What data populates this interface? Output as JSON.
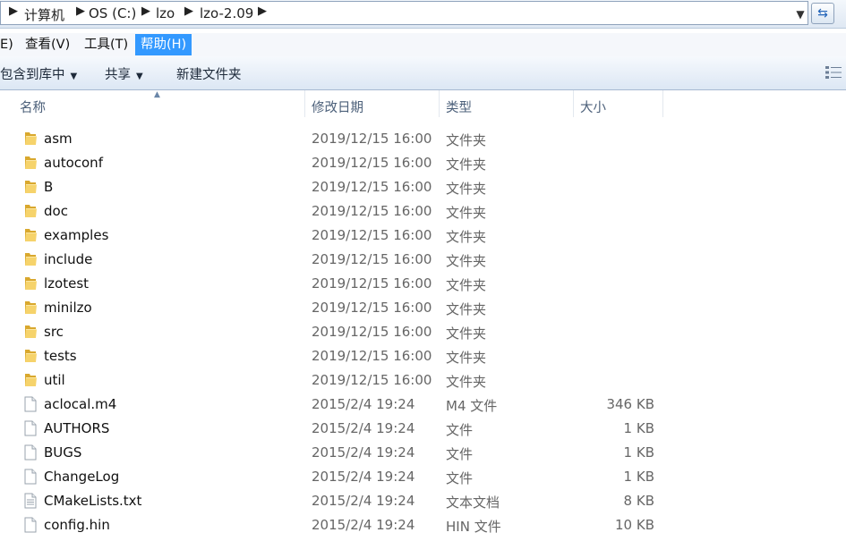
{
  "address": {
    "crumbs": [
      "计算机",
      "OS (C:)",
      "lzo",
      "lzo-2.09"
    ],
    "dropdown_icon": "chevron-down-icon",
    "refresh_icon": "refresh-icon"
  },
  "menu": {
    "items": [
      "E)",
      "查看(V)",
      "工具(T)",
      "帮助(H)"
    ],
    "active_index": 3
  },
  "commands": {
    "include_library": "包含到库中",
    "share": "共享",
    "new_folder": "新建文件夹"
  },
  "columns": {
    "name": "名称",
    "date": "修改日期",
    "type": "类型",
    "size": "大小"
  },
  "files": [
    {
      "name": "asm",
      "date": "2019/12/15 16:00",
      "type": "文件夹",
      "size": "",
      "icon": "folder-icon"
    },
    {
      "name": "autoconf",
      "date": "2019/12/15 16:00",
      "type": "文件夹",
      "size": "",
      "icon": "folder-icon"
    },
    {
      "name": "B",
      "date": "2019/12/15 16:00",
      "type": "文件夹",
      "size": "",
      "icon": "folder-icon"
    },
    {
      "name": "doc",
      "date": "2019/12/15 16:00",
      "type": "文件夹",
      "size": "",
      "icon": "folder-icon"
    },
    {
      "name": "examples",
      "date": "2019/12/15 16:00",
      "type": "文件夹",
      "size": "",
      "icon": "folder-icon"
    },
    {
      "name": "include",
      "date": "2019/12/15 16:00",
      "type": "文件夹",
      "size": "",
      "icon": "folder-icon"
    },
    {
      "name": "lzotest",
      "date": "2019/12/15 16:00",
      "type": "文件夹",
      "size": "",
      "icon": "folder-icon"
    },
    {
      "name": "minilzo",
      "date": "2019/12/15 16:00",
      "type": "文件夹",
      "size": "",
      "icon": "folder-icon"
    },
    {
      "name": "src",
      "date": "2019/12/15 16:00",
      "type": "文件夹",
      "size": "",
      "icon": "folder-icon"
    },
    {
      "name": "tests",
      "date": "2019/12/15 16:00",
      "type": "文件夹",
      "size": "",
      "icon": "folder-icon"
    },
    {
      "name": "util",
      "date": "2019/12/15 16:00",
      "type": "文件夹",
      "size": "",
      "icon": "folder-icon"
    },
    {
      "name": "aclocal.m4",
      "date": "2015/2/4 19:24",
      "type": "M4 文件",
      "size": "346 KB",
      "icon": "file-icon"
    },
    {
      "name": "AUTHORS",
      "date": "2015/2/4 19:24",
      "type": "文件",
      "size": "1 KB",
      "icon": "file-icon"
    },
    {
      "name": "BUGS",
      "date": "2015/2/4 19:24",
      "type": "文件",
      "size": "1 KB",
      "icon": "file-icon"
    },
    {
      "name": "ChangeLog",
      "date": "2015/2/4 19:24",
      "type": "文件",
      "size": "1 KB",
      "icon": "file-icon"
    },
    {
      "name": "CMakeLists.txt",
      "date": "2015/2/4 19:24",
      "type": "文本文档",
      "size": "8 KB",
      "icon": "text-file-icon"
    },
    {
      "name": "config.hin",
      "date": "2015/2/4 19:24",
      "type": "HIN 文件",
      "size": "10 KB",
      "icon": "file-icon"
    }
  ]
}
